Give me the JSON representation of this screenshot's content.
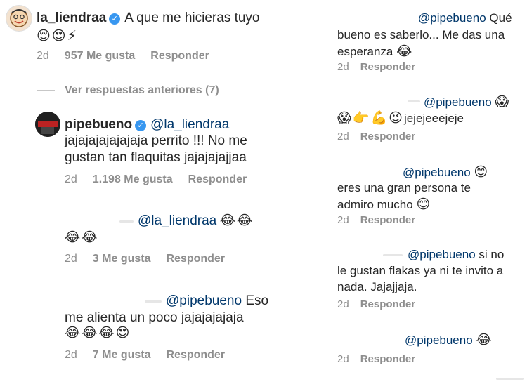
{
  "left": {
    "top_comment": {
      "username": "la_liendraa",
      "text": "A que me hicieras tuyo",
      "emojis": "😌😍⚡",
      "time": "2d",
      "likes": "957 Me gusta",
      "reply": "Responder"
    },
    "view_previous": "Ver respuestas anteriores (7)",
    "reply1": {
      "username": "pipebueno",
      "mention": "@la_liendraa",
      "line1": "jajajajajajajaja perrito !!! No me",
      "line2": "gustan tan flaquitas jajajajajjaa",
      "time": "2d",
      "likes": "1.198 Me gusta",
      "reply": "Responder"
    },
    "reply2": {
      "mention": "@la_liendraa",
      "emojis_inline": "😂😂",
      "emojis_line": "😂😂",
      "time": "2d",
      "likes": "3 Me gusta",
      "reply": "Responder"
    },
    "reply3": {
      "mention": "@pipebueno",
      "text1": "Eso",
      "line2": "me alienta un poco jajajajajaja",
      "emojis": "😂😂😂😍",
      "time": "2d",
      "likes": "7 Me gusta",
      "reply": "Responder"
    }
  },
  "right": {
    "r1": {
      "mention": "@pipebueno",
      "text1": "Qué",
      "line2": "bueno es saberlo... Me das una",
      "line3": "esperanza",
      "emoji3": "😂",
      "time": "2d",
      "reply": "Responder"
    },
    "r2": {
      "mention": "@pipebueno",
      "emoji1": "😱",
      "emojis": "😱👉💪😉",
      "text": "jejejeeejeje",
      "time": "2d",
      "reply": "Responder"
    },
    "r3": {
      "mention": "@pipebueno",
      "emoji1": "😊",
      "line2": "eres una gran persona te",
      "line3": "admiro mucho",
      "emoji3": "😊",
      "time": "2d",
      "reply": "Responder"
    },
    "r4": {
      "mention": "@pipebueno",
      "text1": "si no",
      "line2": "le gustan flakas ya ni te invito a",
      "line3": "nada. Jajajjaja.",
      "time": "2d",
      "reply": "Responder"
    },
    "r5": {
      "mention": "@pipebueno",
      "emoji1": "😂",
      "time": "2d",
      "reply": "Responder"
    }
  }
}
